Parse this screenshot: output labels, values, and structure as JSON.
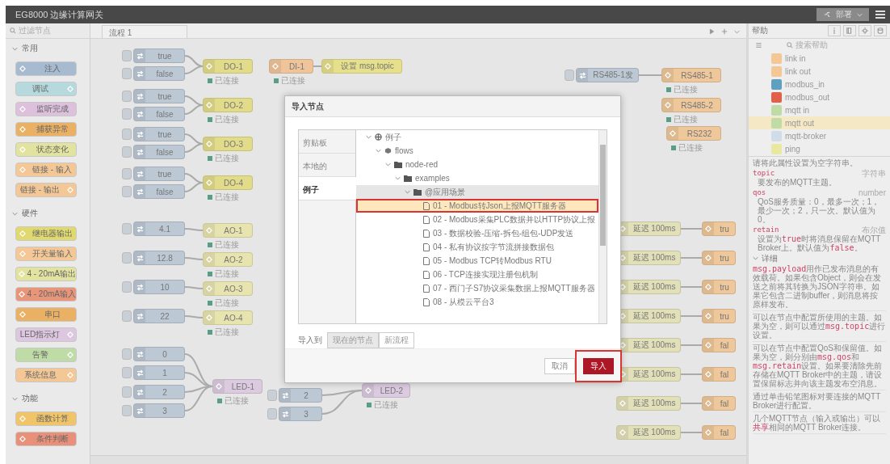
{
  "header": {
    "title": "EG8000 边缘计算网关",
    "deploy": "部署"
  },
  "palette": {
    "search_placeholder": "过滤节点",
    "categories": [
      {
        "title": "常用",
        "expanded": true,
        "nodes": [
          {
            "label": "注入",
            "color": "#a6bbcf",
            "kind": "source"
          },
          {
            "label": "调试",
            "color": "#b5d9dc",
            "kind": "sink"
          },
          {
            "label": "监听完成",
            "color": "#dcc0dc",
            "kind": "source"
          },
          {
            "label": "捕获异常",
            "color": "#eab064",
            "kind": "source"
          },
          {
            "label": "状态变化",
            "color": "#e3e3a0",
            "kind": "source"
          },
          {
            "label": "链接 - 输入",
            "color": "#f3c896",
            "kind": "source"
          },
          {
            "label": "链接 - 输出",
            "color": "#f3c896",
            "kind": "sink"
          }
        ]
      },
      {
        "title": "硬件",
        "expanded": true,
        "nodes": [
          {
            "label": "继电器输出",
            "color": "#e0d970",
            "kind": "source"
          },
          {
            "label": "开关量输入",
            "color": "#f3c896",
            "kind": "source"
          },
          {
            "label": "4 - 20mA输出",
            "color": "#e3e3a0",
            "kind": "source"
          },
          {
            "label": "4 - 20mA输入",
            "color": "#e8957a",
            "kind": "source"
          },
          {
            "label": "串口",
            "color": "#eab064",
            "kind": "source"
          },
          {
            "label": "LED指示灯",
            "color": "#dcc6e0",
            "kind": "sink"
          },
          {
            "label": "告警",
            "color": "#bfdca6",
            "kind": "sink"
          },
          {
            "label": "系统信息",
            "color": "#f3c896",
            "kind": "sink"
          }
        ]
      },
      {
        "title": "功能",
        "expanded": true,
        "nodes": [
          {
            "label": "函数计算",
            "color": "#f0c468",
            "kind": "source"
          },
          {
            "label": "条件判断",
            "color": "#e8907a",
            "kind": "source"
          }
        ]
      }
    ]
  },
  "workspace": {
    "tabs": [
      {
        "label": "流程 1",
        "selected": true
      }
    ],
    "nodes": [
      {
        "label": "true",
        "kind": "inject"
      },
      {
        "label": "false",
        "kind": "inject"
      },
      {
        "label": "true",
        "kind": "inject"
      },
      {
        "label": "false",
        "kind": "inject"
      },
      {
        "label": "true",
        "kind": "inject"
      },
      {
        "label": "false",
        "kind": "inject"
      },
      {
        "label": "true",
        "kind": "inject"
      },
      {
        "label": "false",
        "kind": "inject"
      },
      {
        "label": "4.1",
        "kind": "inject"
      },
      {
        "label": "12.8",
        "kind": "inject"
      },
      {
        "label": "10",
        "kind": "inject"
      },
      {
        "label": "22",
        "kind": "inject"
      },
      {
        "label": "0",
        "kind": "inject"
      },
      {
        "label": "1",
        "kind": "inject"
      },
      {
        "label": "2",
        "kind": "inject"
      },
      {
        "label": "3",
        "kind": "inject"
      },
      {
        "label": "DO-1",
        "kind": "output",
        "status": "已连接"
      },
      {
        "label": "DO-2",
        "kind": "output",
        "status": "已连接"
      },
      {
        "label": "DO-3",
        "kind": "output",
        "status": "已连接"
      },
      {
        "label": "DO-4",
        "kind": "output",
        "status": "已连接"
      },
      {
        "label": "AO-1",
        "kind": "analog",
        "status": "已连接"
      },
      {
        "label": "AO-2",
        "kind": "analog",
        "status": "已连接"
      },
      {
        "label": "AO-3",
        "kind": "analog",
        "status": "已连接"
      },
      {
        "label": "AO-4",
        "kind": "analog",
        "status": "已连接"
      },
      {
        "label": "LED-1",
        "kind": "led",
        "status": "已连接"
      },
      {
        "label": "DI-1",
        "kind": "input",
        "status": "已连接"
      },
      {
        "label": "设置 msg.topic",
        "kind": "change"
      },
      {
        "label": "2",
        "kind": "inject"
      },
      {
        "label": "3",
        "kind": "inject"
      },
      {
        "label": "LED-2",
        "kind": "led",
        "status": "已连接"
      },
      {
        "label": "RS485-1发",
        "kind": "inject"
      },
      {
        "label": "RS485-1",
        "kind": "serial",
        "status": "已连接"
      },
      {
        "label": "RS485-2",
        "kind": "serial",
        "status": "已连接"
      },
      {
        "label": "RS232",
        "kind": "serial",
        "status": "已连接"
      },
      {
        "label": "延迟 100ms",
        "kind": "delay"
      },
      {
        "label": "延迟 100ms",
        "kind": "delay"
      },
      {
        "label": "延迟 100ms",
        "kind": "delay"
      },
      {
        "label": "延迟 100ms",
        "kind": "delay"
      },
      {
        "label": "延迟 100ms",
        "kind": "delay"
      },
      {
        "label": "延迟 100ms",
        "kind": "delay"
      },
      {
        "label": "延迟 100ms",
        "kind": "delay"
      },
      {
        "label": "延迟 100ms",
        "kind": "delay"
      },
      {
        "label": "tru",
        "kind": "serial"
      },
      {
        "label": "tru",
        "kind": "serial"
      },
      {
        "label": "tru",
        "kind": "serial"
      },
      {
        "label": "tru",
        "kind": "serial"
      },
      {
        "label": "fal",
        "kind": "serial"
      },
      {
        "label": "fal",
        "kind": "serial"
      },
      {
        "label": "fal",
        "kind": "serial"
      },
      {
        "label": "fal",
        "kind": "serial"
      }
    ]
  },
  "sidebar": {
    "tab": "帮助",
    "search_placeholder": "搜索帮助",
    "nodes": [
      {
        "label": "link in",
        "color": "#f3c896",
        "selected": false
      },
      {
        "label": "link out",
        "color": "#f3c896",
        "selected": false
      },
      {
        "label": "modbus_in",
        "color": "#5f9fc0",
        "selected": false
      },
      {
        "label": "modbus_out",
        "color": "#e0604a",
        "selected": false
      },
      {
        "label": "mqtt in",
        "color": "#bfdca6",
        "selected": false
      },
      {
        "label": "mqtt out",
        "color": "#bfdca6",
        "selected": true
      },
      {
        "label": "mqtt-broker",
        "color": "#d0dce8",
        "selected": false
      },
      {
        "label": "ping",
        "color": "#e8e8a0",
        "selected": false
      }
    ],
    "intro": "请将此属性设置为空字符串。",
    "properties": [
      {
        "name": "topic",
        "type": "字符串",
        "desc": "要发布的MQTT主题。"
      },
      {
        "name": "qos",
        "type": "number",
        "desc": "QoS服务质量：0，最多一次；1，最少一次；2，只一次。默认值为0。"
      },
      {
        "name": "retain",
        "type": "布尔值",
        "desc": [
          {
            "text": "设置为"
          },
          {
            "text": "true",
            "code": true
          },
          {
            "text": "时将消息保留在MQTT Broker上。默认值为"
          },
          {
            "text": "false",
            "code": true
          },
          {
            "text": "。"
          }
        ]
      }
    ],
    "details_title": "详细",
    "details_expanded": true,
    "paragraphs": [
      [
        {
          "text": "msg.payload",
          "code": true
        },
        {
          "text": "用作已发布消息的有效载荷。如果包含Object，则会在发送之前将其转换为JSON字符串。如果它包含二进制buffer，则消息将按原样发布。"
        }
      ],
      [
        {
          "text": "可以在节点中配置所使用的主题。如果为空，则可以通过"
        },
        {
          "text": "msg.topic",
          "code": true
        },
        {
          "text": "进行设置。"
        }
      ],
      [
        {
          "text": "可以在节点中配置QoS和保留值。如果为空，则分别由"
        },
        {
          "text": "msg.qos",
          "code": true
        },
        {
          "text": "和"
        },
        {
          "text": "msg.retain",
          "code": true
        },
        {
          "text": "设置。如果要清除先前存储在MQTT Broker中的主题，请设置保留标志并向该主题发布空消息。"
        }
      ],
      [
        {
          "text": "通过单击铅笔图标对要连接的MQTT Broker进行配置。"
        }
      ],
      [
        {
          "text": "几个MQTT节点（输入或输出）可以"
        },
        {
          "text": "共享",
          "code": true
        },
        {
          "text": "相同的MQTT Broker连接。"
        }
      ]
    ]
  },
  "dialog": {
    "title": "导入节点",
    "sources": [
      {
        "label": "剪贴板",
        "selected": false
      },
      {
        "label": "本地的",
        "selected": false
      },
      {
        "label": "例子",
        "selected": true
      }
    ],
    "tree": [
      {
        "label": "例子",
        "kind": "globe",
        "selected": false,
        "focused": false,
        "outlined": false,
        "children": [
          {
            "label": "flows",
            "kind": "package",
            "selected": false,
            "focused": false,
            "outlined": false,
            "children": [
              {
                "label": "node-red",
                "kind": "folder",
                "selected": false,
                "focused": false,
                "outlined": false,
                "children": [
                  {
                    "label": "examples",
                    "kind": "folder",
                    "selected": false,
                    "focused": false,
                    "outlined": false,
                    "children": [
                      {
                        "label": "@应用场景",
                        "kind": "folder",
                        "selected": false,
                        "focused": true,
                        "outlined": false,
                        "children": [
                          {
                            "label": "01 - Modbus转Json上报MQTT服务器",
                            "kind": "file",
                            "selected": true,
                            "focused": false,
                            "outlined": true
                          },
                          {
                            "label": "02 - Modbus采集PLC数据并以HTTP协议上报",
                            "kind": "file",
                            "selected": false,
                            "focused": false,
                            "outlined": false
                          },
                          {
                            "label": "03 - 数据校验-压缩-拆包-组包-UDP发送",
                            "kind": "file",
                            "selected": false,
                            "focused": false,
                            "outlined": false
                          },
                          {
                            "label": "04 - 私有协议按字节流拼接数据包",
                            "kind": "file",
                            "selected": false,
                            "focused": false,
                            "outlined": false
                          },
                          {
                            "label": "05 - Modbus TCP转Modbus RTU",
                            "kind": "file",
                            "selected": false,
                            "focused": false,
                            "outlined": false
                          },
                          {
                            "label": "06 - TCP连接实现注册包机制",
                            "kind": "file",
                            "selected": false,
                            "focused": false,
                            "outlined": false
                          },
                          {
                            "label": "07 - 西门子S7协议采集数据上报MQTT服务器",
                            "kind": "file",
                            "selected": false,
                            "focused": false,
                            "outlined": false
                          },
                          {
                            "label": "08 - 从模云平台3",
                            "kind": "file",
                            "selected": false,
                            "focused": false,
                            "outlined": false
                          }
                        ]
                      }
                    ]
                  }
                ]
              }
            ]
          }
        ]
      }
    ],
    "import_to_label": "导入到",
    "targets": [
      {
        "label": "现在的节点",
        "selected": true
      },
      {
        "label": "新流程",
        "selected": false
      }
    ],
    "buttons": [
      {
        "label": "取消",
        "kind": "secondary",
        "outlined": false
      },
      {
        "label": "导入",
        "kind": "primary",
        "outlined": true
      }
    ]
  }
}
